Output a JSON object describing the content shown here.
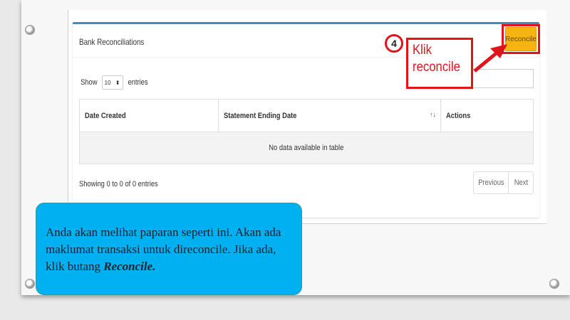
{
  "panel": {
    "title": "Bank Reconciliations",
    "reconcile_button": "Reconcile"
  },
  "length_menu": {
    "prefix": "Show",
    "value": "10",
    "suffix": "entries"
  },
  "table": {
    "columns": [
      "Date Created",
      "Statement Ending Date",
      "Actions"
    ],
    "empty_message": "No data available in table",
    "info": "Showing 0 to 0 of 0 entries"
  },
  "pagination": {
    "previous": "Previous",
    "next": "Next"
  },
  "annotation": {
    "step_number": "4",
    "line1": "Klik",
    "line2": "reconcile",
    "color": "#e0141b"
  },
  "note": {
    "text": "Anda akan melihat paparan seperti ini. Akan ada maklumat transaksi untuk direconcile. Jika ada, klik butang ",
    "emphasis": "Reconcile."
  }
}
